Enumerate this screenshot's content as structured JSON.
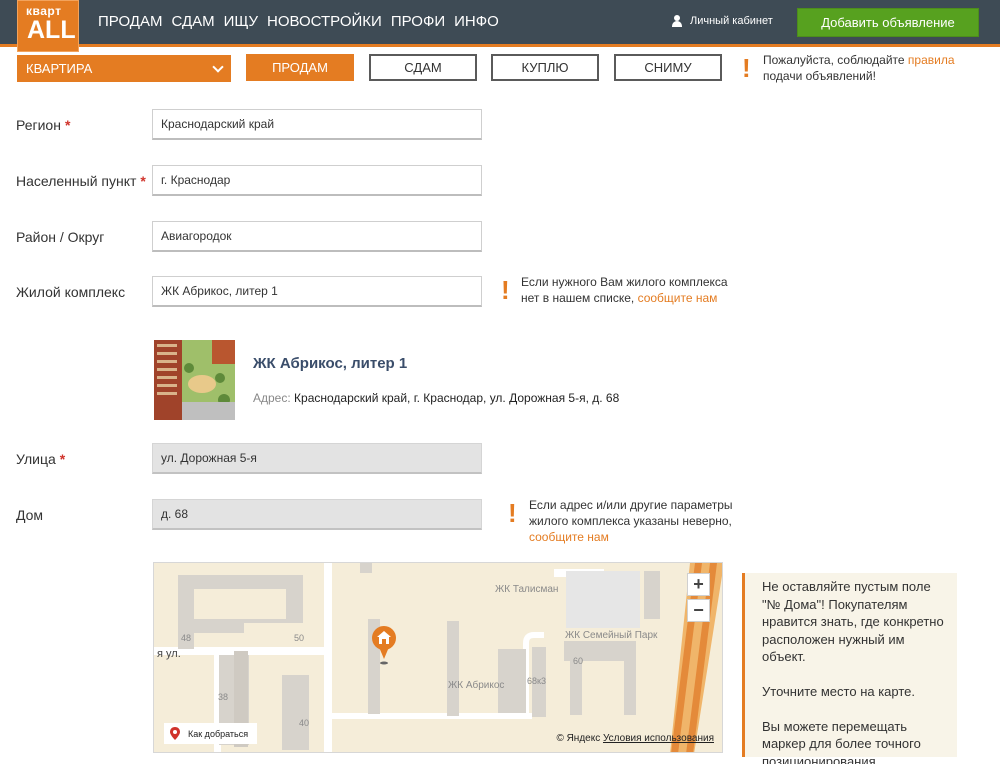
{
  "header": {
    "logo_top": "кварт",
    "logo_main": "ALL",
    "nav": [
      "ПРОДАМ",
      "СДАМ",
      "ИЩУ",
      "НОВОСТРОЙКИ",
      "ПРОФИ",
      "ИНФО"
    ],
    "cabinet": "Личный кабинет",
    "add_button": "Добавить объявление"
  },
  "type_row": {
    "property_type": "КВАРТИРА",
    "deals": [
      "ПРОДАМ",
      "СДАМ",
      "КУПЛЮ",
      "СНИМУ"
    ],
    "active_deal": "ПРОДАМ",
    "rules_note": {
      "before": "Пожалуйста, соблюдайте ",
      "link": "правила",
      "after": " подачи объявлений!"
    }
  },
  "form": {
    "region": {
      "label": "Регион",
      "value": "Краснодарский край"
    },
    "city": {
      "label": "Населенный пункт",
      "value": "г. Краснодар"
    },
    "district": {
      "label": "Район / Округ",
      "value": "Авиагородок"
    },
    "complex": {
      "label": "Жилой комплекс",
      "value": "ЖК Абрикос, литер 1"
    },
    "street": {
      "label": "Улица",
      "value": "ул. Дорожная 5-я"
    },
    "house": {
      "label": "Дом",
      "value": "д. 68"
    },
    "required_mark": "*"
  },
  "complex_note": {
    "text": "Если нужного Вам жилого комплекса нет в нашем списке, ",
    "link": "сообщите нам"
  },
  "complex_card": {
    "title": "ЖК Абрикос, литер 1",
    "address_key": "Адрес:",
    "address": "Краснодарский край, г. Краснодар, ул. Дорожная 5-я, д. 68"
  },
  "address_note": {
    "text": "Если адрес и/или другие параметры жилого комплекса указаны неверно,",
    "link": "сообщите нам"
  },
  "map": {
    "labels": {
      "talisman": "ЖК Талисман",
      "semeyny": "ЖК Семейный Парк",
      "abrikos": "ЖК Абрикос",
      "n48": "48",
      "n50": "50",
      "n38": "38",
      "n40": "40",
      "n60": "60",
      "n68k3": "68к3",
      "street_fragment": "я ул."
    },
    "route": "Как добраться",
    "copyright": "© Яндекс",
    "terms": "Условия использования"
  },
  "tip": {
    "p1": "Не оставляйте пустым поле \"№ Дома\"! Покупателям нравится знать, где конкретно расположен нужный им объект.",
    "p2": "Уточните место на карте.",
    "p3": "Вы можете перемещать маркер для более точного позиционирования."
  },
  "colors": {
    "accent": "#e47c22",
    "header": "#3e4b55",
    "green": "#57a11f",
    "required": "#d0332b"
  }
}
